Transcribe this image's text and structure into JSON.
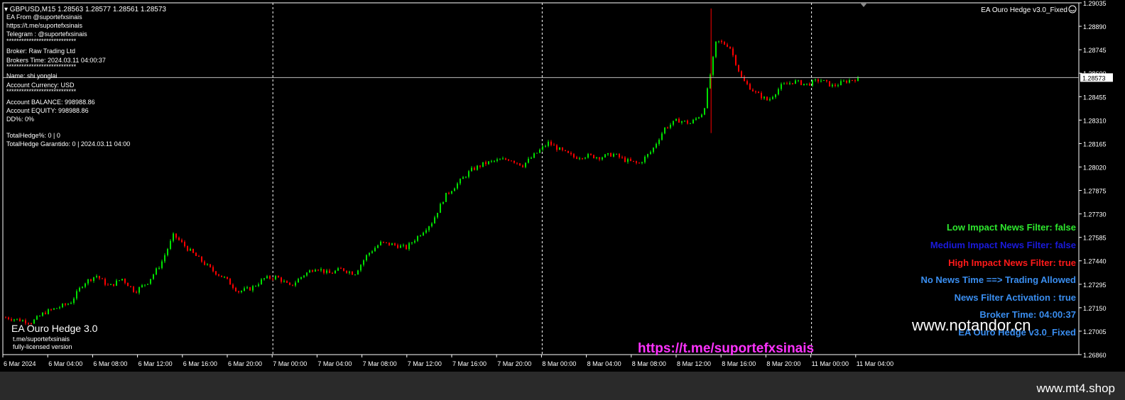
{
  "window": {
    "header": "GBPUSD,M15  1.28563 1.28577 1.28561 1.28573",
    "ea_name_top": "EA Ouro Hedge v3.0_Fixed",
    "current_price": "1.28573"
  },
  "info_panel": {
    "lines": [
      "EA From @suportefxsinais",
      "https://t.me/suportefxsinais",
      " Telegram : @suportefxsinais",
      "****************************",
      " Broker: Raw Trading Ltd",
      " Brokers Time: 2024.03.11 04:00:37",
      "****************************",
      " Name: shi yonglai",
      " Account Currency: USD",
      "****************************",
      " Account BALANCE: 998988.86",
      " Account EQUITY: 998988.86",
      " DD%: 0%",
      "",
      "TotalHedge%: 0 | 0",
      "TotalHedge Garantido: 0 | 2024.03.11 04:00"
    ]
  },
  "news_panel": {
    "items": [
      {
        "text": "Low Impact News Filter: false",
        "color": "#2ee82e"
      },
      {
        "text": "Medium Impact News Filter: false",
        "color": "#1a1adc"
      },
      {
        "text": "High Impact News Filter: true",
        "color": "#ff1a1a"
      },
      {
        "text": "No News Time ==> Trading Allowed",
        "color": "#3a8ef0"
      },
      {
        "text": "News Filter Activation : true",
        "color": "#3a8ef0"
      },
      {
        "text": "Broker Time: 04:00:37",
        "color": "#3a8ef0"
      },
      {
        "text": "EA Ouro Hedge v3.0_Fixed",
        "color": "#3a8ef0"
      }
    ]
  },
  "bottom_left": {
    "title": "EA Ouro Hedge 3.0",
    "link": "t.me/suportefxsinais",
    "license": "fully-licensed version"
  },
  "watermarks": {
    "telegram_link": "https://t.me/suportefxsinais",
    "site": "www.notandor.cn",
    "footer": "www.mt4.shop"
  },
  "colors": {
    "background": "#000000",
    "bull": "#00e000",
    "bear": "#ff0000",
    "grid": "#ffffff",
    "magenta": "#ff33ff"
  },
  "chart_data": {
    "type": "candlestick",
    "symbol": "GBPUSD",
    "timeframe": "M15",
    "ylim": [
      1.2686,
      1.29035
    ],
    "y_ticks": [
      "1.29035",
      "1.28890",
      "1.28745",
      "1.28600",
      "1.28455",
      "1.28310",
      "1.28165",
      "1.28020",
      "1.27875",
      "1.27730",
      "1.27585",
      "1.27440",
      "1.27295",
      "1.27150",
      "1.27005",
      "1.26860"
    ],
    "x_ticks": [
      "6 Mar 2024",
      "6 Mar 04:00",
      "6 Mar 08:00",
      "6 Mar 12:00",
      "6 Mar 16:00",
      "6 Mar 20:00",
      "7 Mar 00:00",
      "7 Mar 04:00",
      "7 Mar 08:00",
      "7 Mar 12:00",
      "7 Mar 16:00",
      "7 Mar 20:00",
      "8 Mar 00:00",
      "8 Mar 04:00",
      "8 Mar 08:00",
      "8 Mar 12:00",
      "8 Mar 16:00",
      "8 Mar 20:00",
      "11 Mar 00:00",
      "11 Mar 04:00"
    ],
    "day_separators": [
      "7 Mar 00:00",
      "8 Mar 00:00",
      "11 Mar 00:00"
    ],
    "current_price": 1.28573,
    "close_path": [
      [
        0,
        1.2709
      ],
      [
        2,
        1.2706
      ],
      [
        3,
        1.2712
      ],
      [
        5,
        1.2718
      ],
      [
        6,
        1.273
      ],
      [
        7,
        1.2735
      ],
      [
        8,
        1.2728
      ],
      [
        9,
        1.2733
      ],
      [
        10,
        1.2725
      ],
      [
        11,
        1.2731
      ],
      [
        12,
        1.2742
      ],
      [
        13,
        1.276
      ],
      [
        14,
        1.2752
      ],
      [
        15,
        1.2745
      ],
      [
        16,
        1.2738
      ],
      [
        17,
        1.2733
      ],
      [
        18,
        1.2725
      ],
      [
        19,
        1.2727
      ],
      [
        20,
        1.2733
      ],
      [
        21,
        1.2734
      ],
      [
        22,
        1.2728
      ],
      [
        23,
        1.2735
      ],
      [
        24,
        1.274
      ],
      [
        25,
        1.2736
      ],
      [
        26,
        1.2739
      ],
      [
        27,
        1.2736
      ],
      [
        28,
        1.2748
      ],
      [
        29,
        1.2755
      ],
      [
        30,
        1.2754
      ],
      [
        31,
        1.2752
      ],
      [
        32,
        1.276
      ],
      [
        33,
        1.2768
      ],
      [
        34,
        1.2784
      ],
      [
        35,
        1.2792
      ],
      [
        36,
        1.28
      ],
      [
        37,
        1.2804
      ],
      [
        38,
        1.2806
      ],
      [
        39,
        1.2807
      ],
      [
        40,
        1.2803
      ],
      [
        41,
        1.281
      ],
      [
        42,
        1.2817
      ],
      [
        43,
        1.2812
      ],
      [
        44,
        1.2808
      ],
      [
        45,
        1.2809
      ],
      [
        46,
        1.2808
      ],
      [
        47,
        1.281
      ],
      [
        48,
        1.2806
      ],
      [
        49,
        1.2804
      ],
      [
        50,
        1.2812
      ],
      [
        51,
        1.2826
      ],
      [
        52,
        1.2831
      ],
      [
        53,
        1.2829
      ],
      [
        54,
        1.2836
      ],
      [
        55,
        1.288
      ],
      [
        56,
        1.2877
      ],
      [
        57,
        1.2856
      ],
      [
        58,
        1.2848
      ],
      [
        59,
        1.2843
      ],
      [
        60,
        1.2852
      ],
      [
        61,
        1.2855
      ],
      [
        62,
        1.2853
      ],
      [
        63,
        1.2856
      ],
      [
        64,
        1.2852
      ],
      [
        65,
        1.2855
      ],
      [
        66,
        1.2857
      ]
    ]
  }
}
